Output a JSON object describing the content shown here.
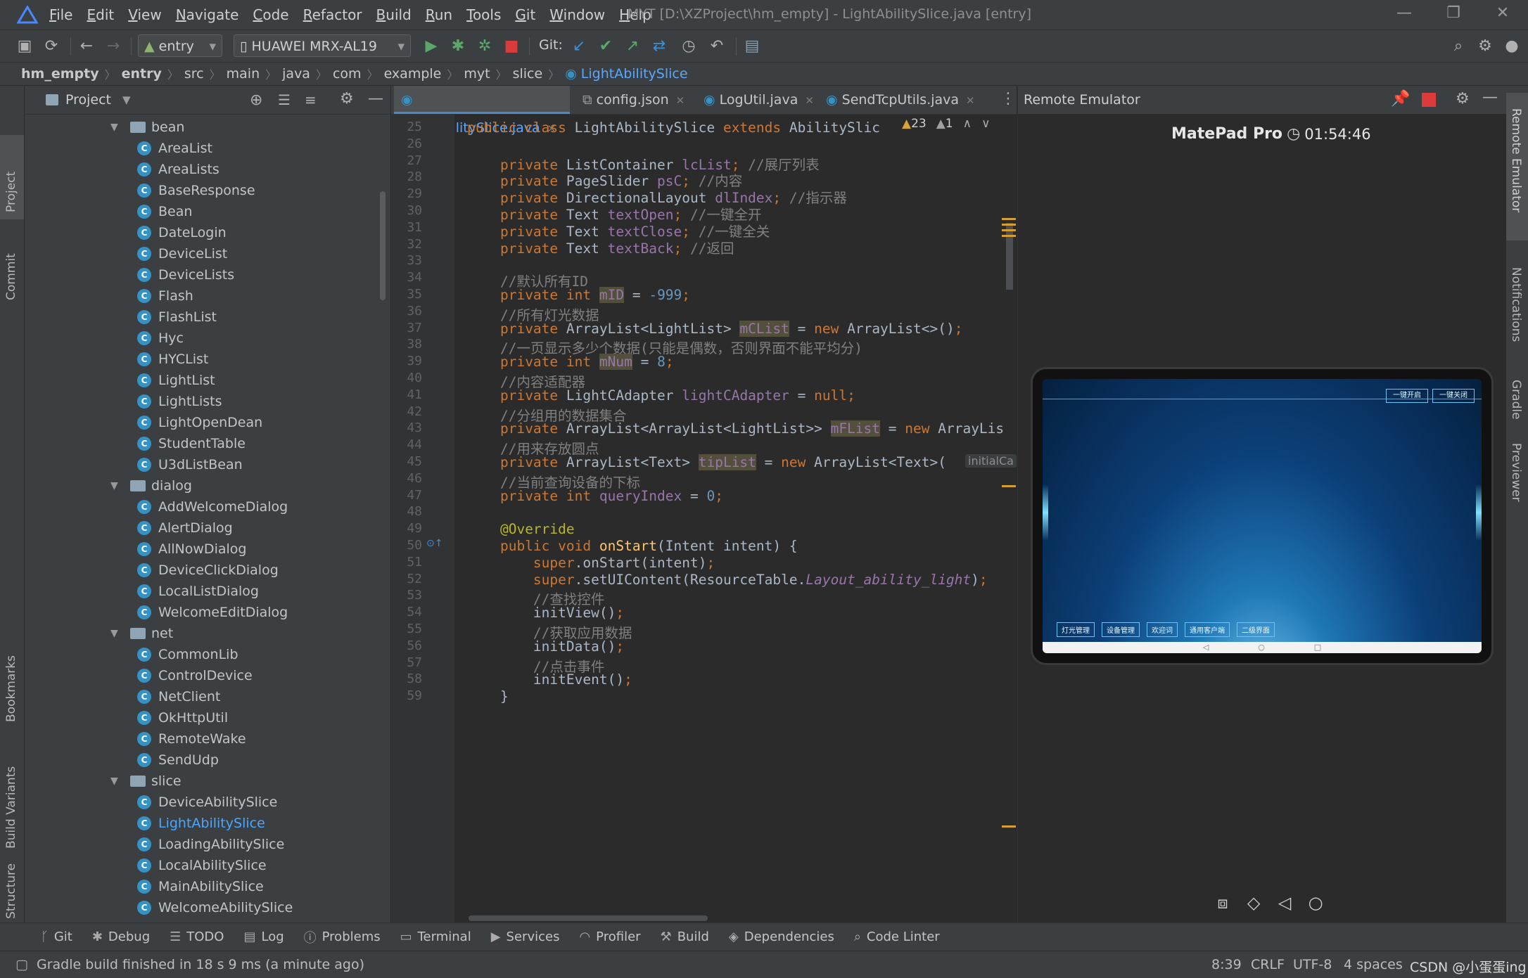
{
  "menubar": {
    "items": [
      "File",
      "Edit",
      "View",
      "Navigate",
      "Code",
      "Refactor",
      "Build",
      "Run",
      "Tools",
      "Git",
      "Window",
      "Help"
    ],
    "title": "MYT [D:\\XZProject\\hm_empty] - LightAbilitySlice.java [entry]"
  },
  "toolbar": {
    "module": "entry",
    "device": "HUAWEI MRX-AL19",
    "git_label": "Git:"
  },
  "breadcrumb": [
    "hm_empty",
    "entry",
    "src",
    "main",
    "java",
    "com",
    "example",
    "myt",
    "slice",
    "LightAbilitySlice"
  ],
  "left_strip": [
    "Project",
    "Commit",
    "Bookmarks",
    "Build Variants",
    "Structure"
  ],
  "project_panel": {
    "title": "Project",
    "tree": [
      {
        "type": "folder",
        "label": "bean",
        "depth": 1
      },
      {
        "type": "class",
        "label": "AreaList",
        "depth": 2
      },
      {
        "type": "class",
        "label": "AreaLists",
        "depth": 2
      },
      {
        "type": "class",
        "label": "BaseResponse",
        "depth": 2
      },
      {
        "type": "class",
        "label": "Bean",
        "depth": 2
      },
      {
        "type": "class",
        "label": "DateLogin",
        "depth": 2
      },
      {
        "type": "class",
        "label": "DeviceList",
        "depth": 2
      },
      {
        "type": "class",
        "label": "DeviceLists",
        "depth": 2
      },
      {
        "type": "class",
        "label": "Flash",
        "depth": 2
      },
      {
        "type": "class",
        "label": "FlashList",
        "depth": 2
      },
      {
        "type": "class",
        "label": "Hyc",
        "depth": 2
      },
      {
        "type": "class",
        "label": "HYCList",
        "depth": 2
      },
      {
        "type": "class",
        "label": "LightList",
        "depth": 2
      },
      {
        "type": "class",
        "label": "LightLists",
        "depth": 2
      },
      {
        "type": "class",
        "label": "LightOpenDean",
        "depth": 2
      },
      {
        "type": "class",
        "label": "StudentTable",
        "depth": 2
      },
      {
        "type": "class",
        "label": "U3dListBean",
        "depth": 2
      },
      {
        "type": "folder",
        "label": "dialog",
        "depth": 1
      },
      {
        "type": "class",
        "label": "AddWelcomeDialog",
        "depth": 2
      },
      {
        "type": "class",
        "label": "AlertDialog",
        "depth": 2
      },
      {
        "type": "class",
        "label": "AllNowDialog",
        "depth": 2
      },
      {
        "type": "class",
        "label": "DeviceClickDialog",
        "depth": 2
      },
      {
        "type": "class",
        "label": "LocalListDialog",
        "depth": 2
      },
      {
        "type": "class",
        "label": "WelcomeEditDialog",
        "depth": 2
      },
      {
        "type": "folder",
        "label": "net",
        "depth": 1
      },
      {
        "type": "class",
        "label": "CommonLib",
        "depth": 2
      },
      {
        "type": "class",
        "label": "ControlDevice",
        "depth": 2
      },
      {
        "type": "class",
        "label": "NetClient",
        "depth": 2
      },
      {
        "type": "class",
        "label": "OkHttpUtil",
        "depth": 2
      },
      {
        "type": "class",
        "label": "RemoteWake",
        "depth": 2
      },
      {
        "type": "class",
        "label": "SendUdp",
        "depth": 2
      },
      {
        "type": "folder",
        "label": "slice",
        "depth": 1
      },
      {
        "type": "class",
        "label": "DeviceAbilitySlice",
        "depth": 2
      },
      {
        "type": "class",
        "label": "LightAbilitySlice",
        "depth": 2,
        "selected": true
      },
      {
        "type": "class",
        "label": "LoadingAbilitySlice",
        "depth": 2
      },
      {
        "type": "class",
        "label": "LocalAbilitySlice",
        "depth": 2
      },
      {
        "type": "class",
        "label": "MainAbilitySlice",
        "depth": 2
      },
      {
        "type": "class",
        "label": "WelcomeAbilitySlice",
        "depth": 2
      }
    ]
  },
  "editor": {
    "tabs": [
      {
        "label": "LightAbilitySlice.java",
        "active": true
      },
      {
        "label": "config.json",
        "active": false
      },
      {
        "label": "LogUtil.java",
        "active": false
      },
      {
        "label": "SendTcpUtils.java",
        "active": false
      }
    ],
    "inspections": {
      "warnings": "23",
      "weak": "1"
    },
    "first_line": 25,
    "inline_hint": "initialCa",
    "lines": [
      [
        [
          "kw",
          "public class "
        ],
        [
          "",
          "LightAbilitySlice "
        ],
        [
          "kw",
          "extends "
        ],
        [
          "",
          "AbilitySlic"
        ]
      ],
      [],
      [
        [
          "",
          "    "
        ],
        [
          "kw",
          "private "
        ],
        [
          "",
          "ListContainer "
        ],
        [
          "fld",
          "lcList"
        ],
        [
          "kw",
          "; "
        ],
        [
          "cmt",
          "//展厅列表"
        ]
      ],
      [
        [
          "",
          "    "
        ],
        [
          "kw",
          "private "
        ],
        [
          "",
          "PageSlider "
        ],
        [
          "fld",
          "psC"
        ],
        [
          "kw",
          "; "
        ],
        [
          "cmt",
          "//内容"
        ]
      ],
      [
        [
          "",
          "    "
        ],
        [
          "kw",
          "private "
        ],
        [
          "",
          "DirectionalLayout "
        ],
        [
          "fld",
          "dlIndex"
        ],
        [
          "kw",
          "; "
        ],
        [
          "cmt",
          "//指示器"
        ]
      ],
      [
        [
          "",
          "    "
        ],
        [
          "kw",
          "private "
        ],
        [
          "",
          "Text "
        ],
        [
          "fld",
          "textOpen"
        ],
        [
          "kw",
          "; "
        ],
        [
          "cmt",
          "//一键全开"
        ]
      ],
      [
        [
          "",
          "    "
        ],
        [
          "kw",
          "private "
        ],
        [
          "",
          "Text "
        ],
        [
          "fld",
          "textClose"
        ],
        [
          "kw",
          "; "
        ],
        [
          "cmt",
          "//一键全关"
        ]
      ],
      [
        [
          "",
          "    "
        ],
        [
          "kw",
          "private "
        ],
        [
          "",
          "Text "
        ],
        [
          "fld",
          "textBack"
        ],
        [
          "kw",
          "; "
        ],
        [
          "cmt",
          "//返回"
        ]
      ],
      [],
      [
        [
          "",
          "    "
        ],
        [
          "cmt",
          "//默认所有ID"
        ]
      ],
      [
        [
          "",
          "    "
        ],
        [
          "kw",
          "private int "
        ],
        [
          "fld hl",
          "mID"
        ],
        [
          "",
          " = "
        ],
        [
          "num",
          "-999"
        ],
        [
          "kw",
          ";"
        ]
      ],
      [
        [
          "",
          "    "
        ],
        [
          "cmt",
          "//所有灯光数据"
        ]
      ],
      [
        [
          "",
          "    "
        ],
        [
          "kw",
          "private "
        ],
        [
          "",
          "ArrayList<LightList> "
        ],
        [
          "fld hl",
          "mCList"
        ],
        [
          "",
          " = "
        ],
        [
          "kw",
          "new "
        ],
        [
          "",
          "ArrayList<>()"
        ],
        [
          "kw",
          ";"
        ]
      ],
      [
        [
          "",
          "    "
        ],
        [
          "cmt",
          "//一页显示多少个数据(只能是偶数，否则界面不能平均分)"
        ]
      ],
      [
        [
          "",
          "    "
        ],
        [
          "kw",
          "private int "
        ],
        [
          "fld hl",
          "mNum"
        ],
        [
          "",
          " = "
        ],
        [
          "num",
          "8"
        ],
        [
          "kw",
          ";"
        ]
      ],
      [
        [
          "",
          "    "
        ],
        [
          "cmt",
          "//内容适配器"
        ]
      ],
      [
        [
          "",
          "    "
        ],
        [
          "kw",
          "private "
        ],
        [
          "",
          "LightCAdapter "
        ],
        [
          "fld",
          "lightCAdapter"
        ],
        [
          "",
          " = "
        ],
        [
          "kw",
          "null;"
        ]
      ],
      [
        [
          "",
          "    "
        ],
        [
          "cmt",
          "//分组用的数据集合"
        ]
      ],
      [
        [
          "",
          "    "
        ],
        [
          "kw",
          "private "
        ],
        [
          "",
          "ArrayList<ArrayList<LightList>> "
        ],
        [
          "fld hl",
          "mFList"
        ],
        [
          "",
          " = "
        ],
        [
          "kw",
          "new "
        ],
        [
          "",
          "ArrayLis"
        ]
      ],
      [
        [
          "",
          "    "
        ],
        [
          "cmt",
          "//用来存放圆点"
        ]
      ],
      [
        [
          "",
          "    "
        ],
        [
          "kw",
          "private "
        ],
        [
          "",
          "ArrayList<Text> "
        ],
        [
          "fld hl",
          "tipList"
        ],
        [
          "",
          " = "
        ],
        [
          "kw",
          "new "
        ],
        [
          "",
          "ArrayList<Text>("
        ]
      ],
      [
        [
          "",
          "    "
        ],
        [
          "cmt",
          "//当前查询设备的下标"
        ]
      ],
      [
        [
          "",
          "    "
        ],
        [
          "kw",
          "private int "
        ],
        [
          "fld",
          "queryIndex"
        ],
        [
          "",
          " = "
        ],
        [
          "num",
          "0"
        ],
        [
          "kw",
          ";"
        ]
      ],
      [],
      [
        [
          "",
          "    "
        ],
        [
          "ann",
          "@Override"
        ]
      ],
      [
        [
          "",
          "    "
        ],
        [
          "kw",
          "public void "
        ],
        [
          "fn",
          "onStart"
        ],
        [
          "",
          "(Intent intent) {"
        ]
      ],
      [
        [
          "",
          "        "
        ],
        [
          "kw",
          "super"
        ],
        [
          "",
          ".onStart(intent)"
        ],
        [
          "kw",
          ";"
        ]
      ],
      [
        [
          "",
          "        "
        ],
        [
          "kw",
          "super"
        ],
        [
          "",
          ".setUIContent(ResourceTable."
        ],
        [
          "it",
          "Layout_ability_light"
        ],
        [
          "",
          ")"
        ],
        [
          "kw",
          ";"
        ]
      ],
      [
        [
          "",
          "        "
        ],
        [
          "cmt",
          "//查找控件"
        ]
      ],
      [
        [
          "",
          "        "
        ],
        [
          "",
          "initView()"
        ],
        [
          "kw",
          ";"
        ]
      ],
      [
        [
          "",
          "        "
        ],
        [
          "cmt",
          "//获取应用数据"
        ]
      ],
      [
        [
          "",
          "        "
        ],
        [
          "",
          "initData()"
        ],
        [
          "kw",
          ";"
        ]
      ],
      [
        [
          "",
          "        "
        ],
        [
          "cmt",
          "//点击事件"
        ]
      ],
      [
        [
          "",
          "        "
        ],
        [
          "",
          "initEvent()"
        ],
        [
          "kw",
          ";"
        ]
      ],
      [
        [
          "",
          "    "
        ],
        [
          "",
          "}"
        ]
      ]
    ]
  },
  "emulator": {
    "panel_title": "Remote Emulator",
    "device_name": "MatePad Pro",
    "timer": "01:54:46",
    "screen": {
      "top_buttons": [
        "一键开启",
        "一键关闭"
      ],
      "bottom_tabs": [
        "灯光管理",
        "设备管理",
        "欢迎词",
        "通用客户端",
        "二级界面"
      ]
    }
  },
  "right_strip": [
    "Remote Emulator",
    "Notifications",
    "Gradle",
    "Previewer"
  ],
  "bottom_tools": [
    "Git",
    "Debug",
    "TODO",
    "Log",
    "Problems",
    "Terminal",
    "Services",
    "Profiler",
    "Build",
    "Dependencies",
    "Code Linter"
  ],
  "status": {
    "message": "Gradle build finished in 18 s 9 ms (a minute ago)",
    "position": "8:39",
    "line_sep": "CRLF",
    "encoding": "UTF-8",
    "indent": "4 spaces",
    "watermark": "CSDN @小蛋蛋ing"
  },
  "colors": {
    "accent": "#4a88c7",
    "keyword": "#cc7832",
    "field": "#9876aa",
    "comment": "#808080",
    "number": "#6897bb",
    "stop": "#db3b3b",
    "run": "#4caf50"
  }
}
